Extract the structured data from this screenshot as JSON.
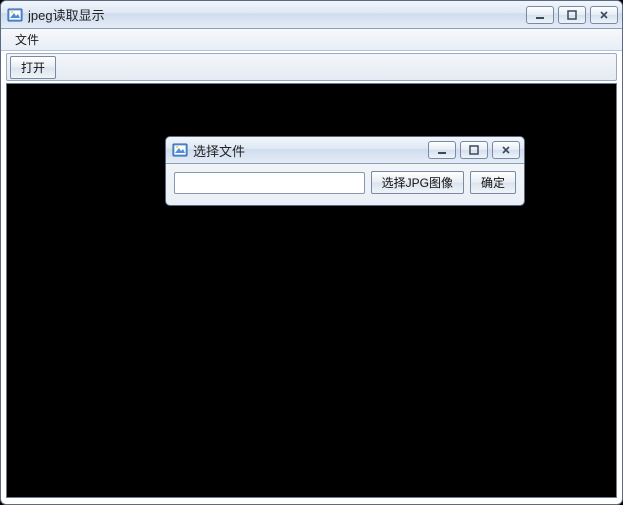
{
  "mainWindow": {
    "title": "jpeg读取显示",
    "menu": {
      "file": "文件"
    },
    "toolbar": {
      "open": "打开"
    }
  },
  "dialog": {
    "title": "选择文件",
    "path": "",
    "chooseBtn": "选择JPG图像",
    "okBtn": "确定"
  }
}
